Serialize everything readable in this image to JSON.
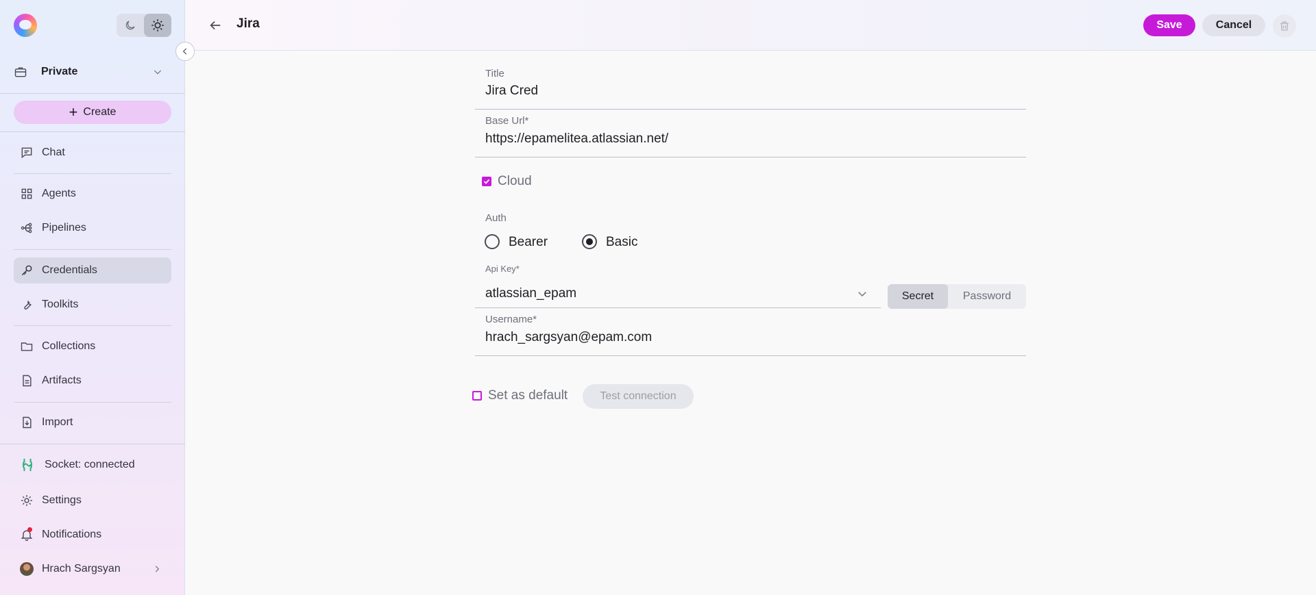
{
  "sidebar": {
    "workspace": {
      "label": "Private"
    },
    "create_label": "Create",
    "items": {
      "chat": "Chat",
      "agents": "Agents",
      "pipelines": "Pipelines",
      "credentials": "Credentials",
      "toolkits": "Toolkits",
      "collections": "Collections",
      "artifacts": "Artifacts",
      "import": "Import",
      "settings": "Settings",
      "notifications": "Notifications"
    },
    "socket_status": "Socket: connected",
    "user_name": "Hrach Sargsyan",
    "active_item": "Credentials",
    "theme": "light"
  },
  "header": {
    "title": "Jira",
    "save_label": "Save",
    "cancel_label": "Cancel"
  },
  "form": {
    "title": {
      "label": "Title",
      "value": "Jira Cred"
    },
    "base_url": {
      "label": "Base Url*",
      "value": "https://epamelitea.atlassian.net/"
    },
    "cloud": {
      "label": "Cloud",
      "checked": true
    },
    "auth": {
      "label": "Auth",
      "options": [
        "Bearer",
        "Basic"
      ],
      "selected": "Basic"
    },
    "api_key": {
      "label": "Api Key*",
      "value": "atlassian_epam",
      "modes": [
        "Secret",
        "Password"
      ],
      "selected_mode": "Secret"
    },
    "username": {
      "label": "Username*",
      "value": "hrach_sargsyan@epam.com"
    },
    "set_default": {
      "label": "Set as default",
      "checked": false
    },
    "test_connection_label": "Test connection"
  },
  "colors": {
    "accent": "#c71ad9",
    "status_connected": "#2db37a"
  }
}
